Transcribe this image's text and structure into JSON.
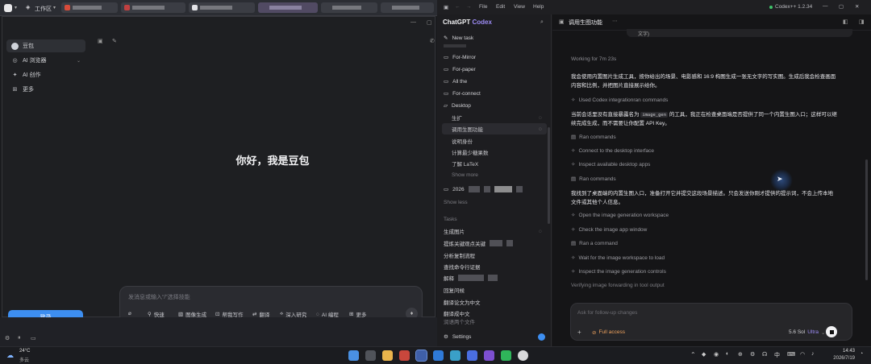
{
  "browser": {
    "workspace_label": "工作区",
    "tab_close": "×"
  },
  "doubao": {
    "sidebar": [
      {
        "label": "豆包",
        "icon": "avatar"
      },
      {
        "label": "AI 浏览器",
        "icon": "globe-icon"
      },
      {
        "label": "AI 创作",
        "icon": "sparkle-icon"
      },
      {
        "label": "更多",
        "icon": "grid-icon"
      }
    ],
    "login_label": "登录",
    "greeting": "你好，我是豆包",
    "input_placeholder": "发消息或输入“/”选择技能",
    "tools": [
      "快速",
      "图像生成",
      "帮我写作",
      "翻译",
      "深入研究",
      "AI 编程",
      "更多"
    ]
  },
  "codex": {
    "menu": [
      "File",
      "Edit",
      "View",
      "Help"
    ],
    "app_title": "Codex++ 1.2.34",
    "brand": "ChatGPT",
    "brand_accent": "Codex",
    "thread_title": "调用生图功能",
    "sidebar": {
      "new_task": "New task",
      "items": [
        {
          "label": "For-Mirror",
          "type": "folder"
        },
        {
          "label": "For-paper",
          "type": "folder"
        },
        {
          "label": "All the",
          "type": "folder"
        },
        {
          "label": "For-connect",
          "type": "folder"
        },
        {
          "label": "Desktop",
          "type": "folder-open"
        },
        {
          "label": "生扩",
          "type": "sub"
        },
        {
          "label": "调用生图功能",
          "type": "sub-selected"
        },
        {
          "label": "说明身份",
          "type": "sub"
        },
        {
          "label": "计算最少糖果数",
          "type": "sub"
        },
        {
          "label": "了解 LaTeX",
          "type": "sub"
        },
        {
          "label": "Show more",
          "type": "muted-sub"
        },
        {
          "label": "2026",
          "type": "folder"
        },
        {
          "label": "Show less",
          "type": "muted"
        }
      ],
      "tasks_header": "Tasks",
      "tasks": [
        "生成图片",
        "提炼关键观点关键",
        "分析复制流程",
        "查找命令行证据",
        "解释",
        "回复问候",
        "翻译论文为中文",
        "翻译成中文",
        "润语两个文件"
      ],
      "settings": "Settings"
    },
    "top_fragment": "文字)",
    "working_for": "Working for 7m 23s",
    "messages": {
      "m1": "我会使用内置图片生成工具，按你给出的场景、电影感和 16:9 构图生成一张无文字的写实图。生成后我会检查画面内容和比例，并把图片直接展示给你。",
      "m2a": "当前会话里没有直接暴露名为",
      "m2code": "image_gen",
      "m2b": "的工具，我正在检查桌面端是否提供了同一个内置生图入口；这样可以继续完成生成，而不需要让你配置 API Key。",
      "m3": "我找到了桌面端的内置生图入口，准备打开它并提交这段场景描述。只会发送你刚才提供的提示词，不会上传本地文件或其他个人信息。"
    },
    "steps": {
      "s1": "Used Codex integrationran commands",
      "s2": "Ran commands",
      "s3": "Connect to the desktop interface",
      "s4": "Inspect available desktop apps",
      "s5": "Ran commands",
      "s6": "Open the image generation workspace",
      "s7": "Check the image app window",
      "s8": "Ran a command",
      "s9": "Wait for the image workspace to load",
      "s10": "Inspect the image generation controls",
      "s11": "Verifying image forwarding in tool output"
    },
    "input": {
      "placeholder": "Ask for follow-up changes",
      "access": "Full access",
      "model": "5.6 Sol",
      "mode": "Ultra"
    }
  },
  "taskbar": {
    "temp": "24°C",
    "weather": "多云",
    "ime": "中",
    "time": "14:43",
    "date": "2026/7/19"
  },
  "colors": {
    "accent": "#3d8ef0",
    "codex_accent": "#9d8cf5",
    "access": "#f0a35e"
  }
}
